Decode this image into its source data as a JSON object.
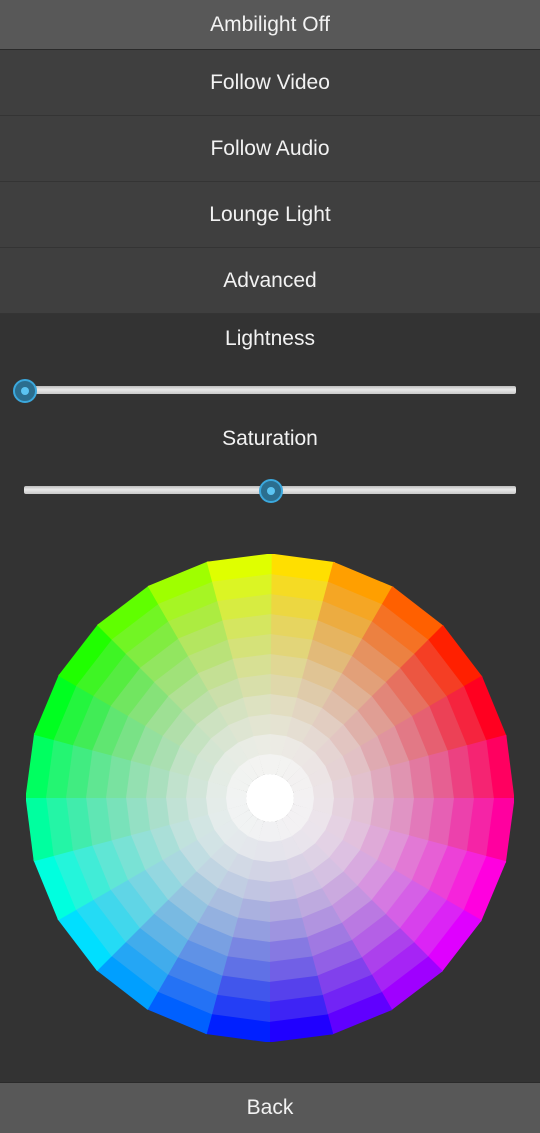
{
  "menu": {
    "ambilight_off": "Ambilight Off",
    "follow_video": "Follow Video",
    "follow_audio": "Follow Audio",
    "lounge_light": "Lounge Light",
    "advanced": "Advanced"
  },
  "sliders": {
    "lightness": {
      "label": "Lightness",
      "value": 0.0
    },
    "saturation": {
      "label": "Saturation",
      "value": 0.5
    }
  },
  "color_wheel": {
    "segments": 24,
    "rings": 11
  },
  "footer": {
    "back": "Back"
  }
}
